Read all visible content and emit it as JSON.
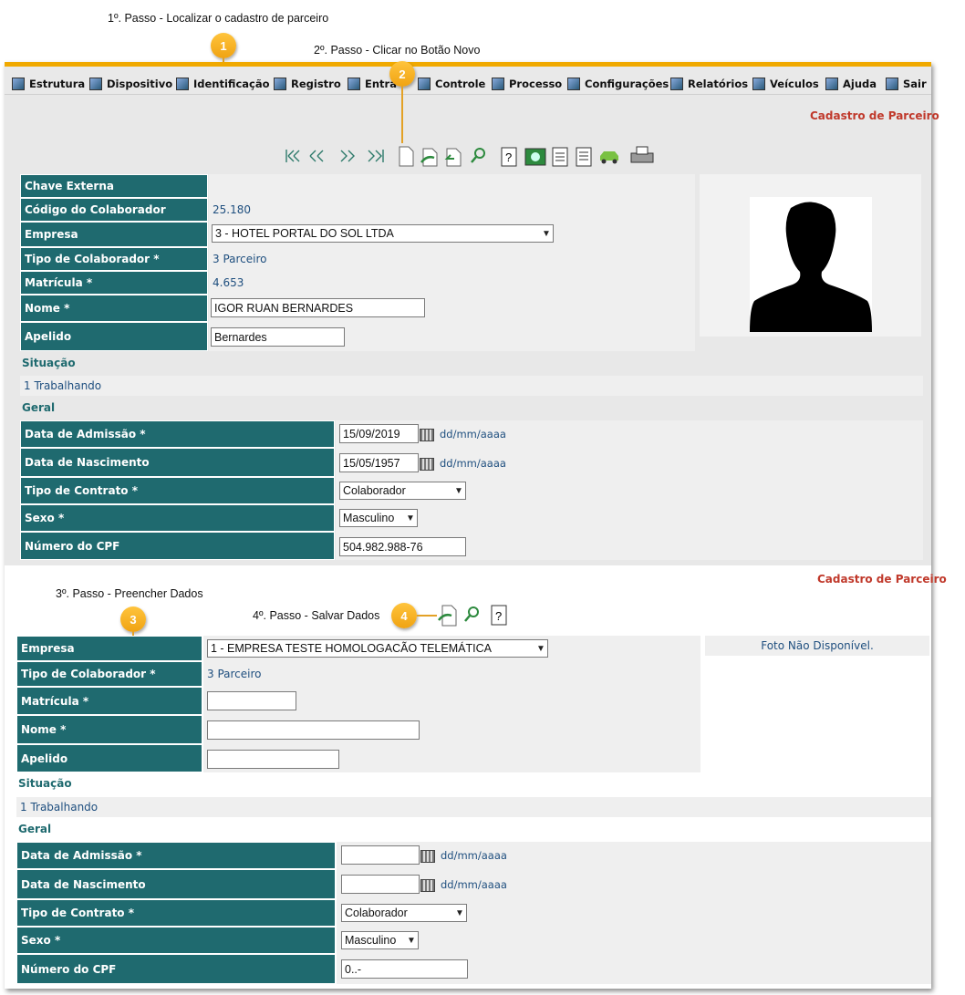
{
  "steps": {
    "step1": "1º. Passo - Localizar o cadastro de parceiro",
    "step2": "2º. Passo - Clicar no Botão Novo",
    "step3": "3º. Passo - Preencher Dados",
    "step4": "4º. Passo - Salvar Dados"
  },
  "callouts": {
    "c1": "1",
    "c2": "2",
    "c3": "3",
    "c4": "4"
  },
  "menu": {
    "items": [
      "Estrutura",
      "Dispositivo",
      "Identificação",
      "Registro",
      "Entra",
      "Controle",
      "Processo",
      "Configurações",
      "Relatórios",
      "Veículos",
      "Ajuda",
      "Sair"
    ]
  },
  "form1": {
    "title": "Cadastro de Parceiro",
    "labels": {
      "chave_externa": "Chave Externa",
      "codigo": "Código do Colaborador",
      "empresa": "Empresa",
      "tipo": "Tipo de Colaborador *",
      "matricula": "Matrícula *",
      "nome": "Nome *",
      "apelido": "Apelido",
      "situacao": "Situação",
      "geral": "Geral",
      "admissao": "Data de Admissão *",
      "nascimento": "Data de Nascimento",
      "contrato": "Tipo de Contrato *",
      "sexo": "Sexo *",
      "cpf": "Número do CPF"
    },
    "values": {
      "chave_externa": "",
      "codigo": "25.180",
      "empresa": "3 - HOTEL PORTAL DO SOL LTDA",
      "tipo": "3 Parceiro",
      "matricula": "4.653",
      "nome": "IGOR RUAN BERNARDES",
      "apelido": "Bernardes",
      "situacao": "1 Trabalhando",
      "admissao": "15/09/2019",
      "nascimento": "15/05/1957",
      "date_hint": "dd/mm/aaaa",
      "contrato": "Colaborador",
      "sexo": "Masculino",
      "cpf": "504.982.988-76"
    }
  },
  "form2": {
    "title": "Cadastro de Parceiro",
    "photo_text": "Foto Não Disponível.",
    "labels": {
      "empresa": "Empresa",
      "tipo": "Tipo de Colaborador *",
      "matricula": "Matrícula *",
      "nome": "Nome *",
      "apelido": "Apelido",
      "situacao": "Situação",
      "geral": "Geral",
      "admissao": "Data de Admissão *",
      "nascimento": "Data de Nascimento",
      "contrato": "Tipo de Contrato *",
      "sexo": "Sexo *",
      "cpf": "Número do CPF"
    },
    "values": {
      "empresa": "1 - EMPRESA TESTE HOMOLOGACÃO TELEMÁTICA",
      "tipo": "3 Parceiro",
      "matricula": "",
      "nome": "",
      "apelido": "",
      "situacao": "1 Trabalhando",
      "admissao": "",
      "nascimento": "",
      "date_hint": "dd/mm/aaaa",
      "contrato": "Colaborador",
      "sexo": "Masculino",
      "cpf": "0..-"
    }
  },
  "colors": {
    "label_bg": "#1f6a6f",
    "accent": "#f0a900",
    "title_red": "#c0392b",
    "value_blue": "#1f4f7f"
  }
}
